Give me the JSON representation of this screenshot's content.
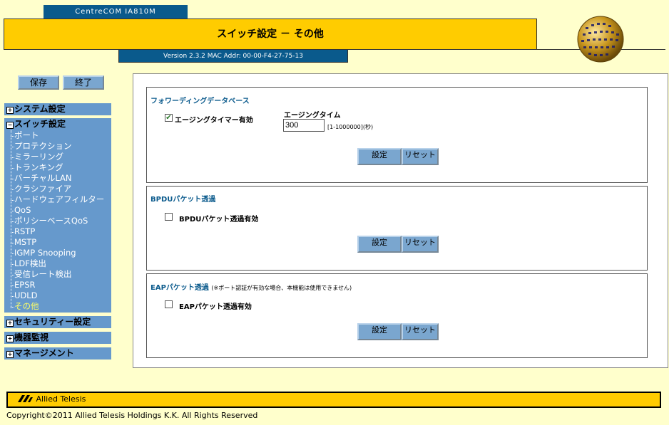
{
  "header": {
    "model": "CentreCOM IA810M",
    "title": "スイッチ設定 － その他",
    "version": "Version 2.3.2 MAC Addr: 00-00-F4-27-75-13"
  },
  "toolbar": {
    "save": "保存",
    "exit": "終了"
  },
  "sidebar": {
    "system": "システム設定",
    "switch": "スイッチ設定",
    "items": [
      "ポート",
      "プロテクション",
      "ミラーリング",
      "トランキング",
      "バーチャルLAN",
      "クラシファイア",
      "ハードウェアフィルター",
      "QoS",
      "ポリシーベースQoS",
      "RSTP",
      "MSTP",
      "IGMP Snooping",
      "LDF検出",
      "受信レート検出",
      "EPSR",
      "UDLD",
      "その他"
    ],
    "security": "セキュリティー設定",
    "monitor": "機器監視",
    "management": "マネージメント"
  },
  "fdb": {
    "title": "フォワーディングデータベース",
    "aging_enable_label": "エージングタイマー有効",
    "aging_enabled": true,
    "aging_time_label": "エージングタイム",
    "aging_time_value": "300",
    "aging_range": "[1-1000000](秒)",
    "set": "設定",
    "reset": "リセット"
  },
  "bpdu": {
    "title": "BPDUパケット透過",
    "enable_label": "BPDUパケット透過有効",
    "enabled": false,
    "set": "設定",
    "reset": "リセット"
  },
  "eap": {
    "title": "EAPパケット透過",
    "note": "(※ポート認証が有効な場合、本機能は使用できません)",
    "enable_label": "EAPパケット透過有効",
    "enabled": false,
    "set": "設定",
    "reset": "リセット"
  },
  "footer": {
    "logo": "Allied Telesis",
    "copyright": "Copyright©2011 Allied Telesis Holdings K.K. All Rights Reserved"
  },
  "colors": {
    "yellow": "#ffcc00",
    "navy": "#0a5a8c",
    "menu_blue": "#6699cc",
    "background": "#ffffcc"
  }
}
